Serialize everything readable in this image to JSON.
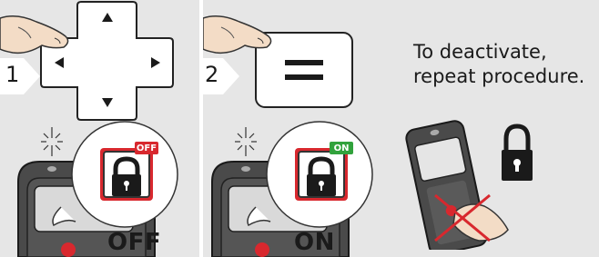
{
  "panel1": {
    "step": "1",
    "state_label": "OFF",
    "badge": "OFF"
  },
  "panel2": {
    "step": "2",
    "state_label": "ON",
    "badge": "ON"
  },
  "instruction": {
    "line1": "To deactivate,",
    "line2": "repeat procedure."
  },
  "icons": {
    "dpad": "dpad-arrow-key-icon",
    "equals": "equals-key-icon",
    "hand": "pressing-hand-icon",
    "lock": "padlock-icon",
    "device": "laser-meter-device-icon"
  },
  "colors": {
    "panel_bg": "#e6e6e6",
    "badge_off": "#d8282e",
    "badge_on": "#31a23c",
    "lock_frame": "#d8282e",
    "cross": "#d8282e"
  }
}
